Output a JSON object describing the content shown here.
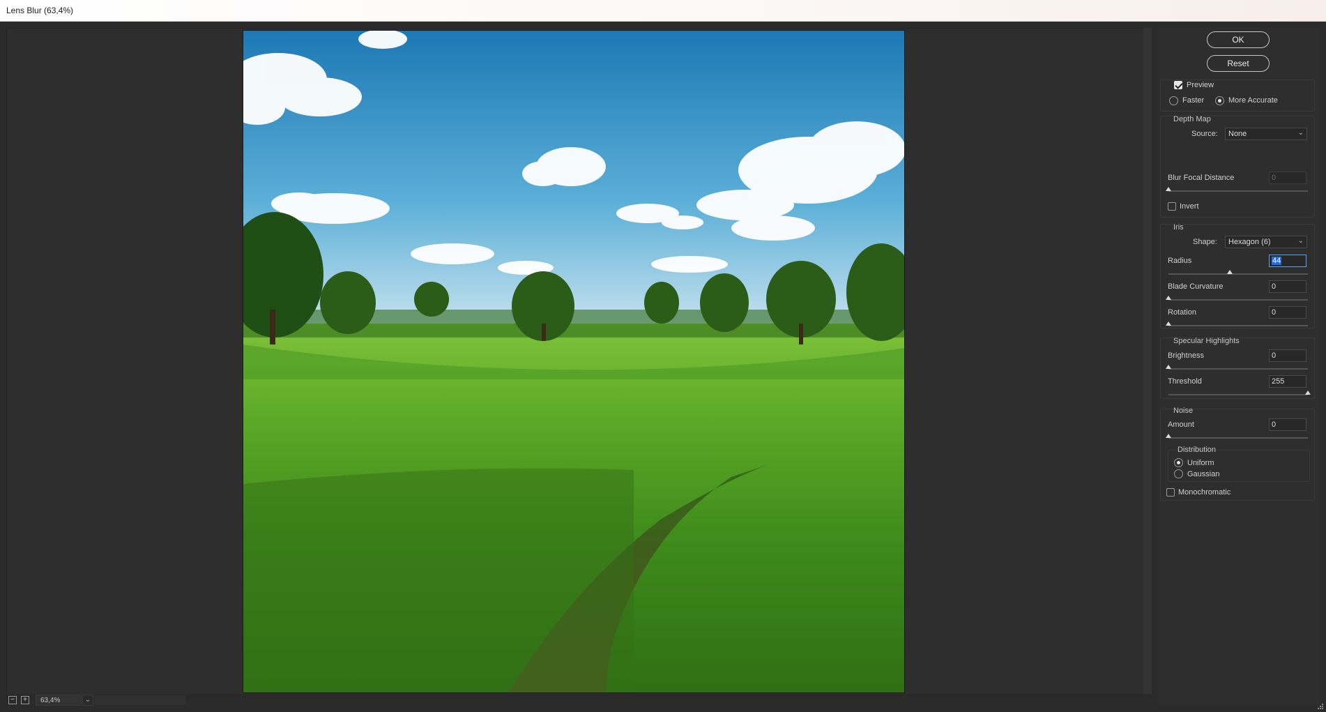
{
  "window": {
    "title": "Lens Blur (63,4%)"
  },
  "zoom": {
    "value": "63,4%",
    "zoom_out_icon": "minus-square-icon",
    "zoom_in_icon": "plus-square-icon"
  },
  "buttons": {
    "ok": "OK",
    "reset": "Reset"
  },
  "preview": {
    "label": "Preview",
    "checked": true,
    "faster": "Faster",
    "more_accurate": "More Accurate",
    "selected": "More Accurate"
  },
  "depth_map": {
    "title": "Depth Map",
    "source_label": "Source:",
    "source_value": "None",
    "focal_label": "Blur Focal Distance",
    "focal_value": "0",
    "focal_level": 0,
    "invert_label": "Invert",
    "invert_checked": false
  },
  "iris": {
    "title": "Iris",
    "shape_label": "Shape:",
    "shape_value": "Hexagon (6)",
    "radius_label": "Radius",
    "radius_value": "44",
    "radius_level": 0.44,
    "curvature_label": "Blade Curvature",
    "curvature_value": "0",
    "curvature_level": 0,
    "rotation_label": "Rotation",
    "rotation_value": "0",
    "rotation_level": 0
  },
  "specular": {
    "title": "Specular Highlights",
    "brightness_label": "Brightness",
    "brightness_value": "0",
    "brightness_level": 0,
    "threshold_label": "Threshold",
    "threshold_value": "255",
    "threshold_level": 1
  },
  "noise": {
    "title": "Noise",
    "amount_label": "Amount",
    "amount_value": "0",
    "amount_level": 0,
    "distribution_title": "Distribution",
    "uniform": "Uniform",
    "gaussian": "Gaussian",
    "selected": "Uniform",
    "monochromatic_label": "Monochromatic",
    "monochromatic_checked": false
  },
  "colors": {
    "panel_bg": "#2e2e2e",
    "accent": "#1f6fdc",
    "sky_top": "#1f7fb8",
    "grass": "#4e9a1e"
  }
}
